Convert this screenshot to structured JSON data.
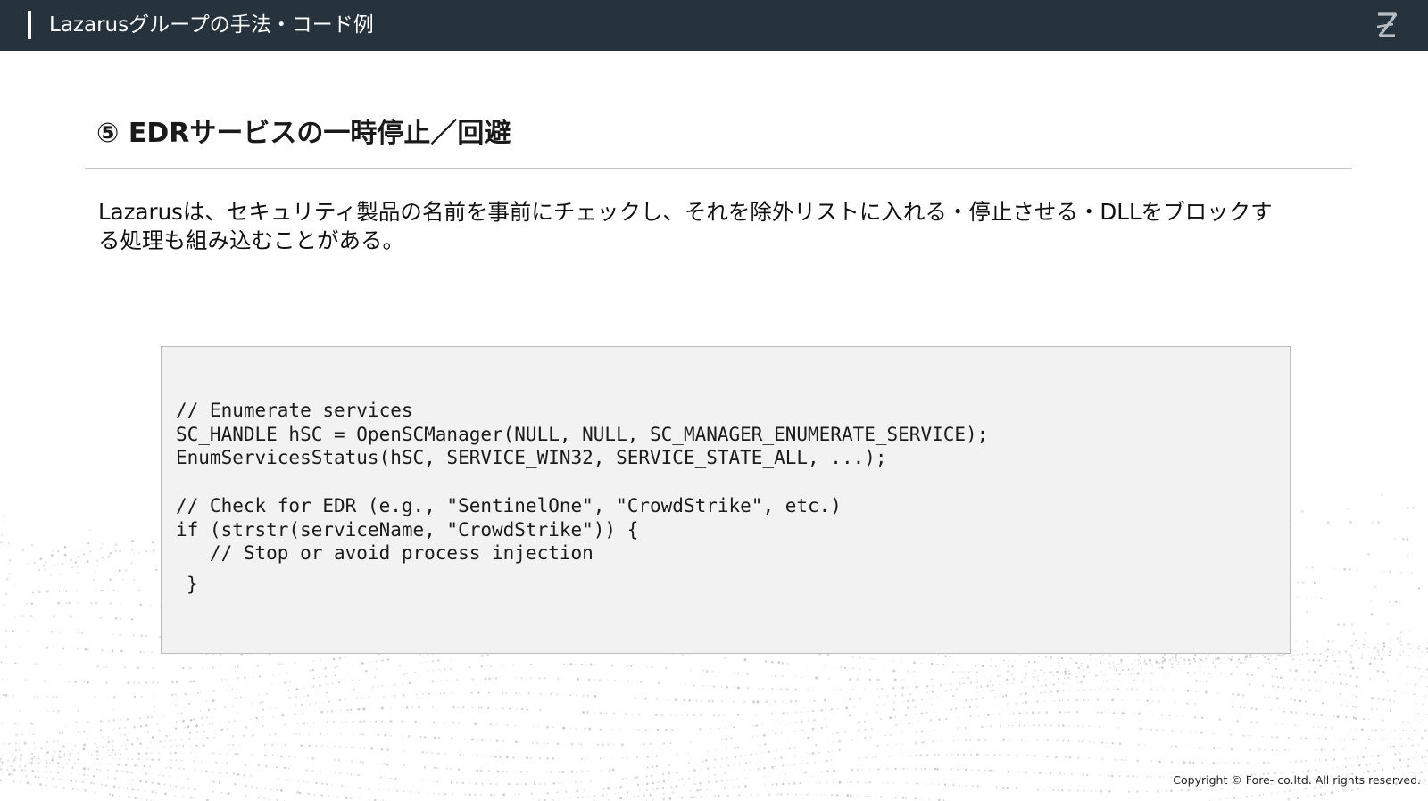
{
  "header": {
    "title": "Lazarusグループの手法・コード例",
    "logo_icon": "z-logo-icon"
  },
  "section": {
    "heading": "⑤ EDRサービスの一時停止／回避",
    "description": "Lazarusは、セキュリティ製品の名前を事前にチェックし、それを除外リストに入れる・停止させる・DLLをブロックする処理も組み込むことがある。"
  },
  "code_block": {
    "lines": [
      "// Enumerate services",
      "SC_HANDLE hSC = OpenSCManager(NULL, NULL, SC_MANAGER_ENUMERATE_SERVICE);",
      "EnumServicesStatus(hSC, SERVICE_WIN32, SERVICE_STATE_ALL, ...);",
      "",
      "// Check for EDR (e.g., \"SentinelOne\", \"CrowdStrike\", etc.)",
      "if (strstr(serviceName, \"CrowdStrike\")) {",
      "   // Stop or avoid process injection"
    ],
    "closing": "}"
  },
  "footer": {
    "copyright": "Copyright © Fore- co.ltd. All rights reserved."
  },
  "colors": {
    "header_bg": "#26323c",
    "code_bg": "#f2f2f2",
    "rule": "#c9c9c9"
  }
}
